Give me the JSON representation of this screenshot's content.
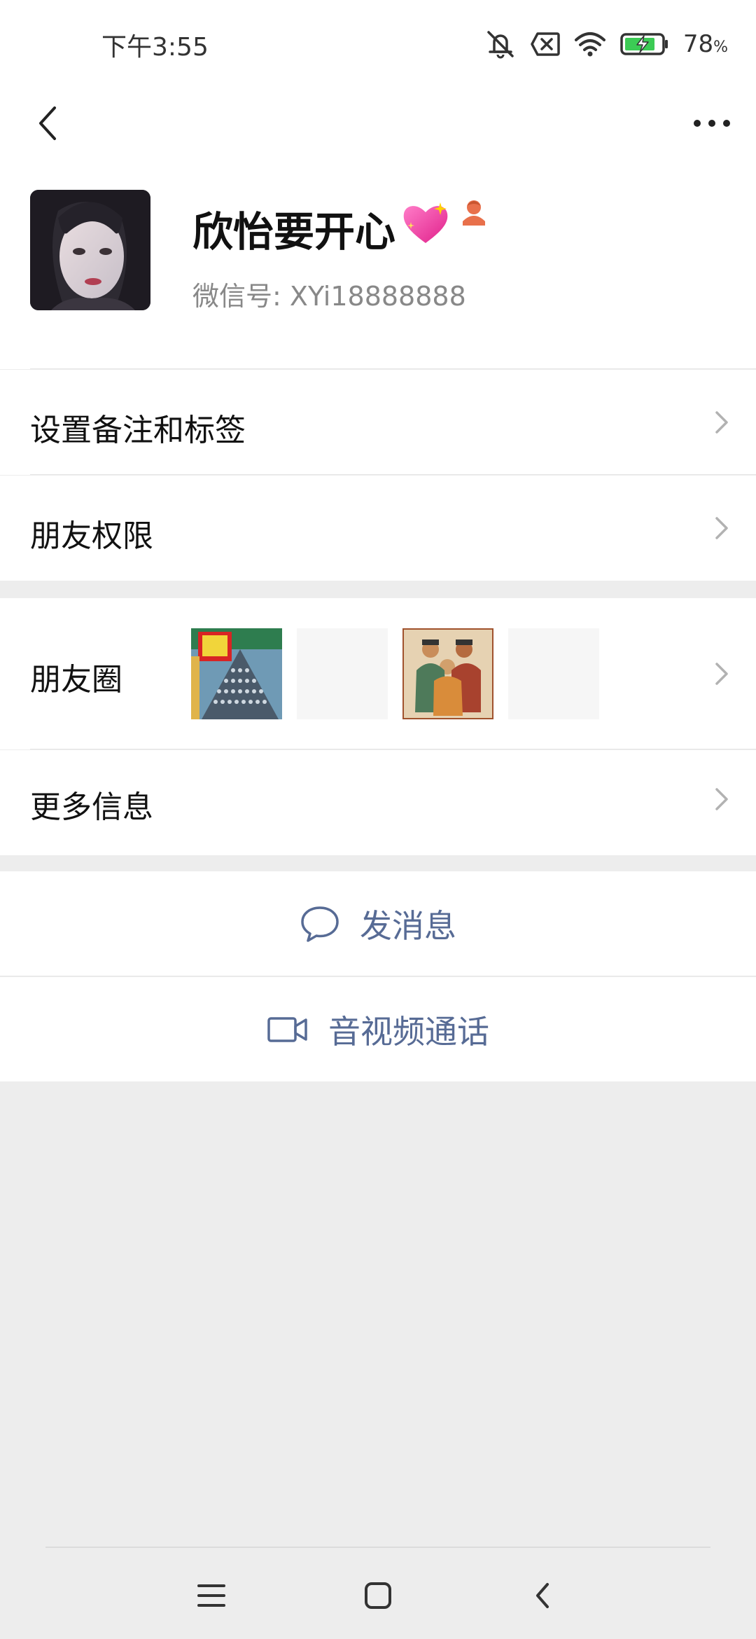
{
  "status_bar": {
    "time": "下午3:55",
    "battery_percent": "78",
    "battery_unit": "%"
  },
  "profile": {
    "display_name": "欣怡要开心",
    "name_emoji": "💖",
    "wechat_id_label": "微信号:",
    "wechat_id": "XYi18888888"
  },
  "menu": {
    "remark_tags": "设置备注和标签",
    "friend_permissions": "朋友权限",
    "moments": "朋友圈",
    "more_info": "更多信息"
  },
  "actions": {
    "send_message": "发消息",
    "video_call": "音视频通话"
  },
  "colors": {
    "accent_link": "#576b95",
    "background": "#ededed",
    "badge_orange": "#e8704b"
  },
  "icons": {
    "back": "back-arrow-icon",
    "more": "more-dots-icon",
    "chevron": "chevron-right-icon",
    "message": "chat-bubble-icon",
    "video": "video-camera-icon"
  }
}
